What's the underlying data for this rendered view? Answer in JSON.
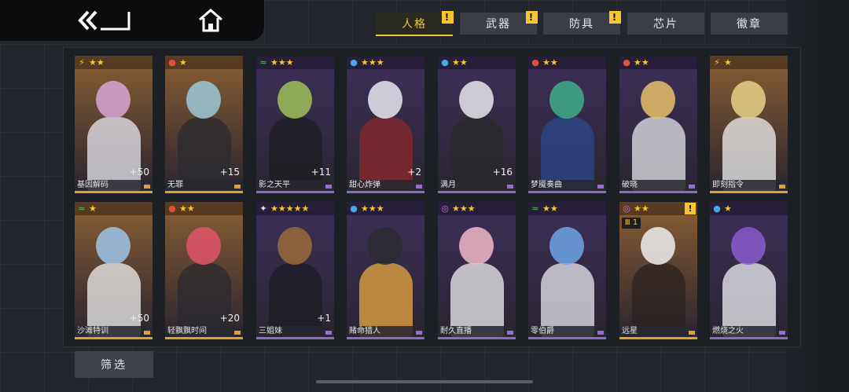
{
  "tabs": [
    {
      "label": "人格",
      "alert": "!",
      "active": true
    },
    {
      "label": "武器",
      "alert": "!",
      "active": false
    },
    {
      "label": "防具",
      "alert": "!",
      "active": false
    },
    {
      "label": "芯片",
      "alert": "",
      "active": false
    },
    {
      "label": "徽章",
      "alert": "",
      "active": false
    }
  ],
  "filter_label": "筛选",
  "colors": {
    "accent": "#f6c531",
    "card_bg": "#2f2f3a",
    "card_orange": "#8a5a2a",
    "card_purple": "#3a2f55"
  },
  "cards": [
    {
      "name": "基因解码",
      "element": "lightning",
      "stars": "★★",
      "plus": "+50",
      "bg": "#8a5e33",
      "hair": "#d9a6d4",
      "outfit": "#e8e8f0"
    },
    {
      "name": "无罪",
      "element": "fire",
      "stars": "★",
      "plus": "+15",
      "bg": "#8a5e33",
      "hair": "#9cc9d8",
      "outfit": "#2b2b30"
    },
    {
      "name": "影之天平",
      "element": "wind",
      "stars": "★★★",
      "plus": "+11",
      "bg": "#3d2f5a",
      "hair": "#9fbf5a",
      "outfit": "#1e1e22"
    },
    {
      "name": "甜心炸弹",
      "element": "water",
      "stars": "★★★",
      "plus": "+2",
      "bg": "#3d2f5a",
      "hair": "#e8e8ee",
      "outfit": "#8a2a2a"
    },
    {
      "name": "满月",
      "element": "water",
      "stars": "★★",
      "plus": "+16",
      "bg": "#3d2f5a",
      "hair": "#e6e6ea",
      "outfit": "#2a2a2a"
    },
    {
      "name": "梦魇奏曲",
      "element": "fire",
      "stars": "★★",
      "plus": "",
      "bg": "#3d2f5a",
      "hair": "#3fae8a",
      "outfit": "#2a4a8a"
    },
    {
      "name": "破晓",
      "element": "fire",
      "stars": "★★",
      "plus": "",
      "bg": "#3d2f5a",
      "hair": "#e8c168",
      "outfit": "#e6e6ea"
    },
    {
      "name": "即刻指令",
      "element": "lightning",
      "stars": "★",
      "plus": "",
      "bg": "#8a5e33",
      "hair": "#e8d08a",
      "outfit": "#f0f0f0"
    },
    {
      "name": "沙滩特训",
      "element": "wind",
      "stars": "★",
      "plus": "+50",
      "bg": "#8a5e33",
      "hair": "#9ec6ea",
      "outfit": "#f0f0f0"
    },
    {
      "name": "轻飘飘时间",
      "element": "fire",
      "stars": "★★",
      "plus": "+20",
      "bg": "#8a5e33",
      "hair": "#e0556a",
      "outfit": "#2a2a30"
    },
    {
      "name": "三姐妹",
      "element": "light",
      "stars": "★★★★★",
      "plus": "+1",
      "bg": "#3d2f5a",
      "hair": "#9a6a3a",
      "outfit": "#1e1e24"
    },
    {
      "name": "赌命猎人",
      "element": "water",
      "stars": "★★★",
      "plus": "",
      "bg": "#3d2f5a",
      "hair": "#2a2a30",
      "outfit": "#e8a840"
    },
    {
      "name": "耐久直播",
      "element": "spiral",
      "stars": "★★★",
      "plus": "",
      "bg": "#3d2f5a",
      "hair": "#f0b8c8",
      "outfit": "#f0f0f0"
    },
    {
      "name": "零伯爵",
      "element": "wind",
      "stars": "★★",
      "plus": "",
      "bg": "#3d2f5a",
      "hair": "#6ea6e6",
      "outfit": "#e8e8ee"
    },
    {
      "name": "远星",
      "element": "spiral",
      "stars": "★★",
      "plus": "",
      "bg": "#8a5e33",
      "hair": "#eeeeee",
      "outfit": "#2a2220",
      "alert": "!",
      "rank": "Ⅲ 1"
    },
    {
      "name": "燃烧之火",
      "element": "water",
      "stars": "★",
      "plus": "",
      "bg": "#3d2f5a",
      "hair": "#8a5ad0",
      "outfit": "#f0f0f4"
    }
  ],
  "element_icons": {
    "lightning": {
      "glyph": "⚡",
      "color": "#f6c531"
    },
    "fire": {
      "glyph": "●",
      "color": "#e0503a"
    },
    "wind": {
      "glyph": "≈",
      "color": "#5ac05a"
    },
    "water": {
      "glyph": "●",
      "color": "#4aa8e8"
    },
    "light": {
      "glyph": "✦",
      "color": "#e8e8e8"
    },
    "spiral": {
      "glyph": "◎",
      "color": "#c070e0"
    }
  }
}
